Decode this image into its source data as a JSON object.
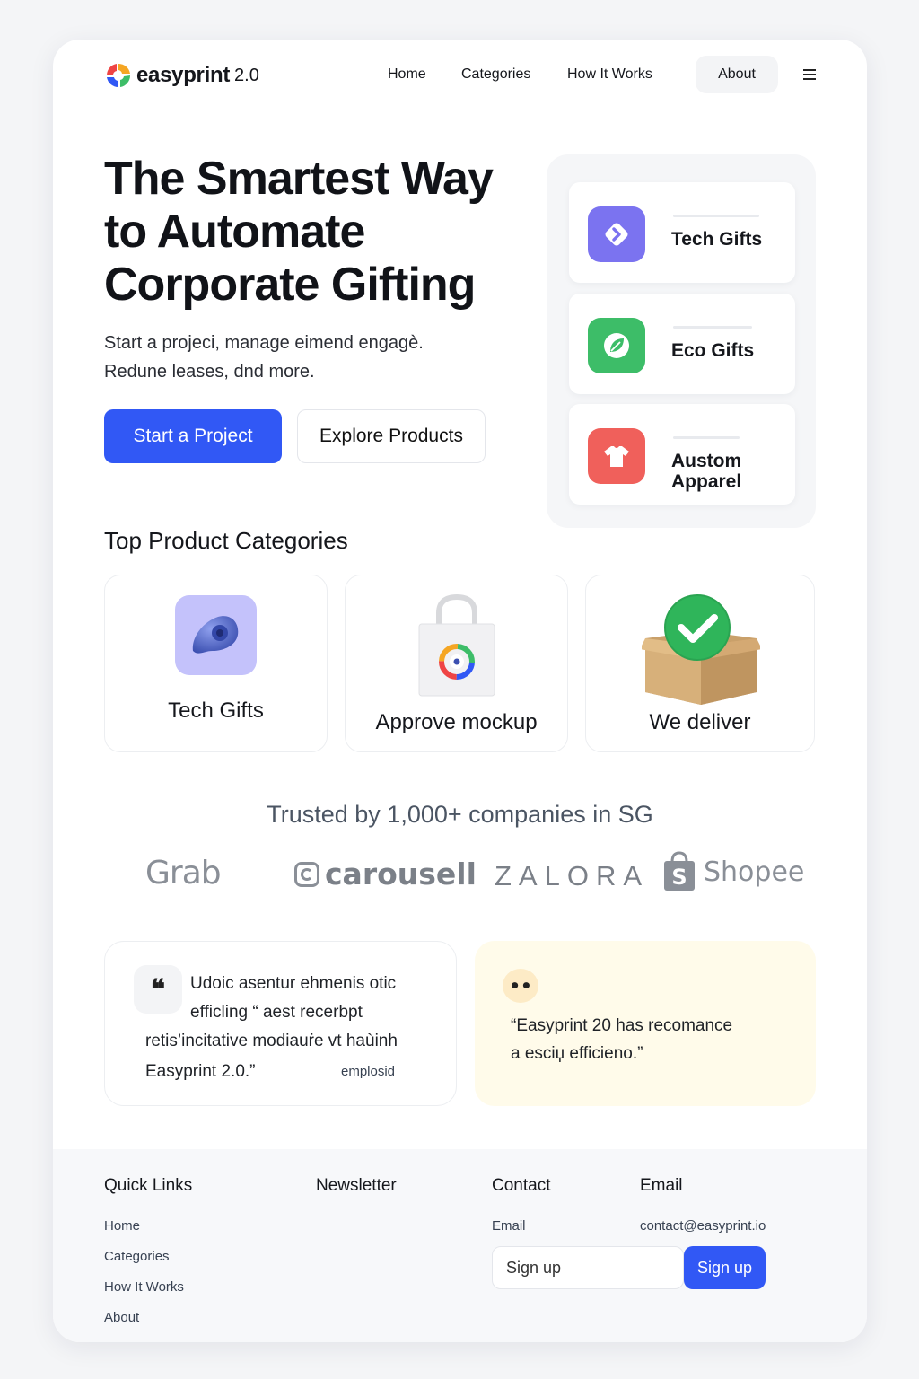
{
  "brand": {
    "name": "easyprint",
    "version": "2.0"
  },
  "nav": {
    "links": [
      "Home",
      "Categories",
      "How It Works"
    ],
    "about": "About"
  },
  "hero": {
    "title_lines": [
      "The Smartest Way",
      "to Automate",
      "Corporate Gifting"
    ],
    "subtitle_lines": [
      "Start a projeci, manage eimend engagè.",
      "Redune leases, dnd more."
    ],
    "primary_cta": "Start a Project",
    "secondary_cta": "Explore Products"
  },
  "side_cards": [
    {
      "label": "Tech Gifts",
      "icon": "tag-icon",
      "color": "#7b73f0"
    },
    {
      "label": "Eco Gifts",
      "icon": "leaf-icon",
      "color": "#3dbd68"
    },
    {
      "label_lines": [
        "Austom",
        "Apparel"
      ],
      "icon": "tshirt-icon",
      "color": "#f0605b"
    }
  ],
  "categories": {
    "title": "Top Product Categories",
    "items": [
      {
        "label": "Tech Gifts",
        "icon": "earbud-icon"
      },
      {
        "label": "Approve mockup",
        "icon": "tote-bag-icon"
      },
      {
        "label": "We deliver",
        "icon": "delivered-box-icon"
      }
    ]
  },
  "trusted": {
    "title": "Trusted by 1,000+ companies in SG",
    "logos": [
      "Grab",
      "carousell",
      "ZALORA",
      "Shopee"
    ]
  },
  "testimonials": [
    {
      "quote_mark": "❝",
      "lines": [
        "Udoic asentur ehmenis otic",
        "efficling “ aest recerbpt",
        "retis’incitative modiauṙe vt haùinh",
        "Easyprint 2.0.”"
      ],
      "author": "emplosid"
    },
    {
      "quote_mark": "••",
      "lines": [
        "“Easyprint 20 has recomance",
        "a esciџ efficieno.”"
      ]
    }
  ],
  "footer": {
    "quick_links_title": "Quick Links",
    "quick_links": [
      "Home",
      "Categories",
      "How It Works",
      "About"
    ],
    "newsletter_title": "Newsletter",
    "contact_title": "Contact",
    "contact_label": "Email",
    "email_title": "Email",
    "email_value": "contact@easyprint.io",
    "signup_placeholder": "Sign up",
    "signup_button": "Sign up"
  },
  "colors": {
    "accent": "#3158f5",
    "page_bg": "#f4f5f7",
    "testimonial_highlight": "#fffbea"
  }
}
